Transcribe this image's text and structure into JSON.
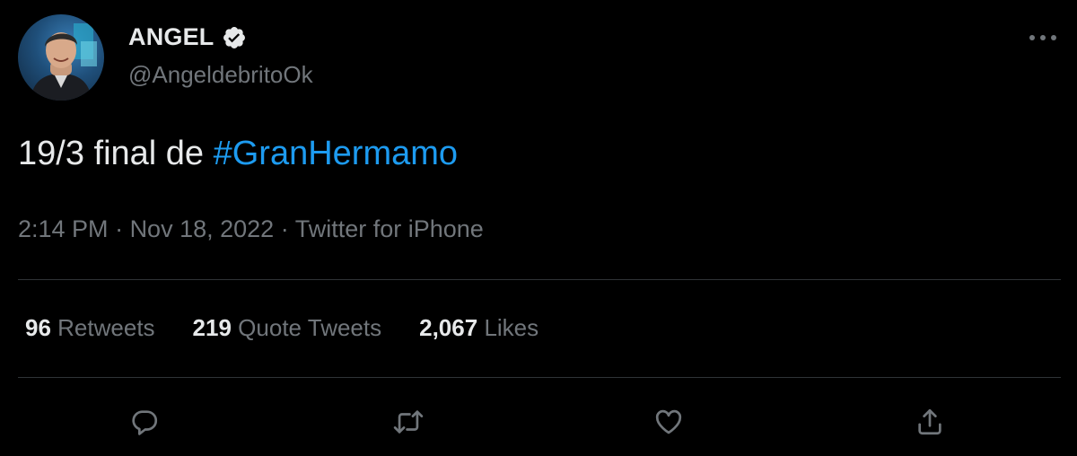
{
  "author": {
    "display_name": "ANGEL",
    "handle": "@AngeldebritoOk",
    "verified_icon": "verified-badge-icon",
    "avatar": "avatar-photo"
  },
  "tweet": {
    "text_prefix": "19/3 final de ",
    "hashtag": "#GranHermamo",
    "time": "2:14 PM",
    "separator1": " · ",
    "date": "Nov 18, 2022",
    "separator2": " · ",
    "source": "Twitter for iPhone"
  },
  "stats": {
    "retweets_count": "96",
    "retweets_label": "Retweets",
    "quotes_count": "219",
    "quotes_label": "Quote Tweets",
    "likes_count": "2,067",
    "likes_label": "Likes"
  },
  "actions": [
    "reply-icon",
    "retweet-icon",
    "like-icon",
    "share-icon"
  ],
  "colors": {
    "background": "#000000",
    "primary_text": "#e7e9ea",
    "secondary_text": "#71767b",
    "link": "#1d9bf0",
    "divider": "#2f3336"
  }
}
